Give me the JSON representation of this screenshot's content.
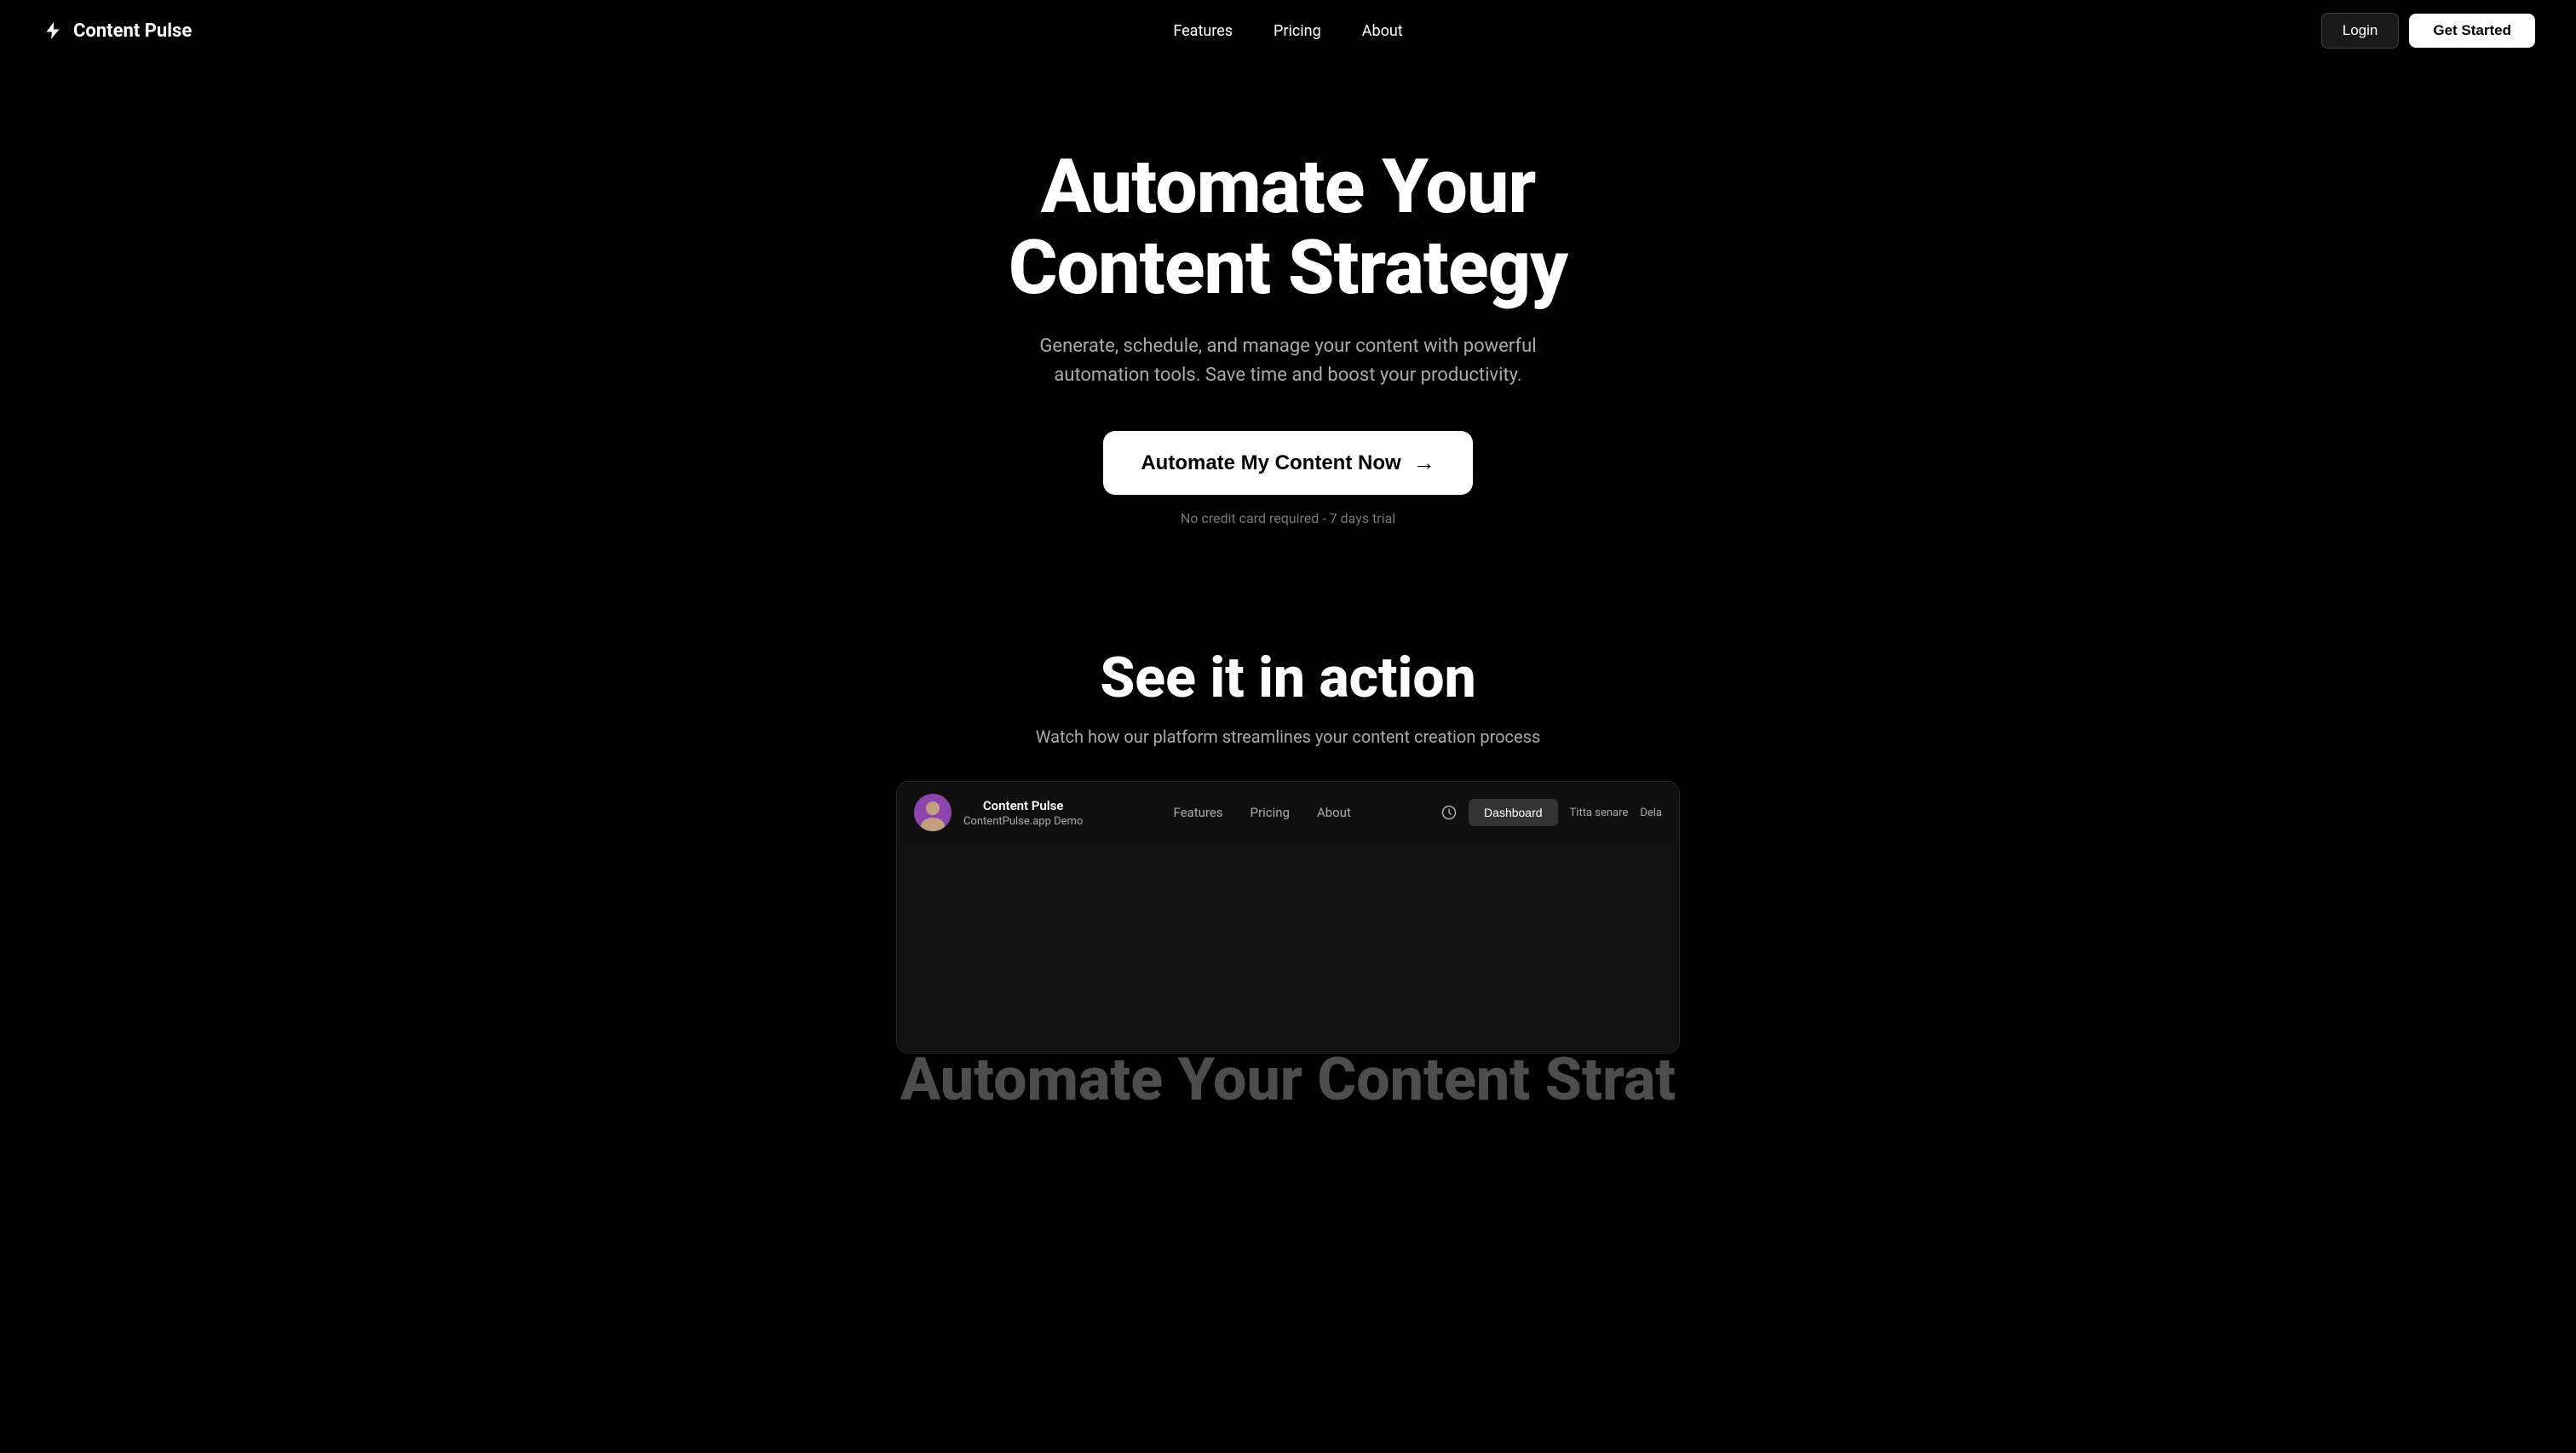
{
  "brand": {
    "name": "Content Pulse",
    "icon": "⚡"
  },
  "nav": {
    "links": [
      {
        "label": "Features",
        "href": "#features"
      },
      {
        "label": "Pricing",
        "href": "#pricing"
      },
      {
        "label": "About",
        "href": "#about"
      }
    ],
    "login_label": "Login",
    "get_started_label": "Get Started"
  },
  "hero": {
    "title": "Automate Your Content Strategy",
    "subtitle": "Generate, schedule, and manage your content with powerful automation tools. Save time and boost your productivity.",
    "cta_label": "Automate My Content Now",
    "cta_note": "No credit card required - 7 days trial"
  },
  "see_in_action": {
    "title": "See it in action",
    "subtitle": "Watch how our platform streamlines your content creation process"
  },
  "video_bar": {
    "channel_name": "Content Pulse",
    "channel_note": "ContentPulse.app Demo",
    "nav_links": [
      "Features",
      "Pricing",
      "About"
    ],
    "watch_later": "Titta senare",
    "share": "Dela",
    "dashboard_label": "Dashboard"
  },
  "bottom_hero_text": "Automate Your Content Strat"
}
